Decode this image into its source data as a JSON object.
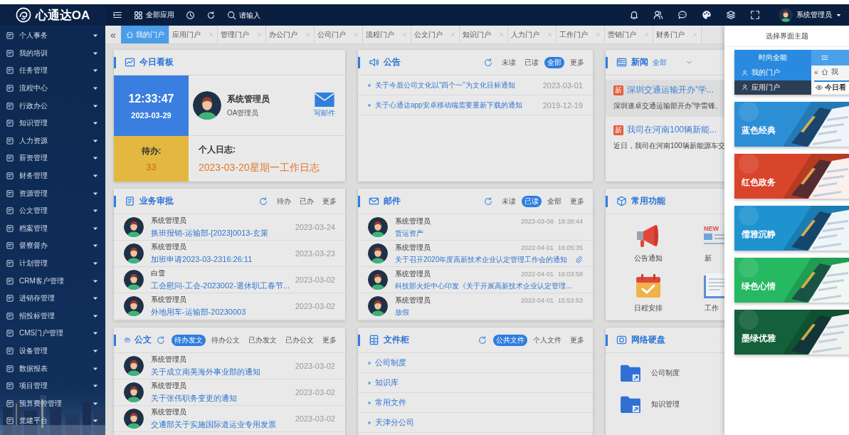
{
  "brand": {
    "name": "心通达OA"
  },
  "sidebar": {
    "items": [
      {
        "label": "个人事务"
      },
      {
        "label": "我的培训"
      },
      {
        "label": "任务管理"
      },
      {
        "label": "流程中心"
      },
      {
        "label": "行政办公"
      },
      {
        "label": "知识管理"
      },
      {
        "label": "人力资源"
      },
      {
        "label": "薪资管理"
      },
      {
        "label": "财务管理"
      },
      {
        "label": "资源管理"
      },
      {
        "label": "公文管理"
      },
      {
        "label": "档案管理"
      },
      {
        "label": "督察督办"
      },
      {
        "label": "计划管理"
      },
      {
        "label": "CRM客户管理"
      },
      {
        "label": "进销存管理"
      },
      {
        "label": "招投标管理"
      },
      {
        "label": "CMS门户管理"
      },
      {
        "label": "设备管理"
      },
      {
        "label": "数据报表"
      },
      {
        "label": "项目管理"
      },
      {
        "label": "预算费控管理"
      },
      {
        "label": "党建平台"
      }
    ]
  },
  "topbar": {
    "apps_button": "全部应用",
    "search": {
      "placeholder": "请输入"
    },
    "user_name": "系统管理员"
  },
  "tabs": {
    "collapse": "«",
    "items": [
      {
        "label": "我的门户",
        "selected": true
      },
      {
        "label": "应用门户",
        "selected": false
      },
      {
        "label": "管理门户",
        "selected": false
      },
      {
        "label": "办公门户",
        "selected": false
      },
      {
        "label": "公司门户",
        "selected": false
      },
      {
        "label": "流程门户",
        "selected": false
      },
      {
        "label": "公文门户",
        "selected": false
      },
      {
        "label": "知识门户",
        "selected": false
      },
      {
        "label": "人力门户",
        "selected": false
      },
      {
        "label": "工作门户",
        "selected": false
      },
      {
        "label": "营销门户",
        "selected": false
      },
      {
        "label": "财务门户",
        "selected": false
      }
    ]
  },
  "panels": [
    {
      "kind": "dashboard",
      "title": "今日看板",
      "time": "12:33:47",
      "date": "2023-03-29",
      "user": "系统管理员",
      "role": "OA管理员",
      "compose": "写邮件",
      "todo_label": "待办:",
      "todo_count": "33",
      "log_label": "个人日志:",
      "log_entry": "2023-03-20星期一工作日志"
    },
    {
      "kind": "notice",
      "title": "公告",
      "filters": [
        {
          "label": "未读",
          "selected": false
        },
        {
          "label": "已读",
          "selected": false
        },
        {
          "label": "全部",
          "selected": true
        }
      ],
      "more": "更多",
      "items": [
        {
          "title": "关于今后公司文化以“四个一”为文化目标通知",
          "date": "2023-03-01"
        },
        {
          "title": "关于心通达app安卓移动端需要重新下载的通知",
          "date": "2019-12-19"
        }
      ]
    },
    {
      "kind": "news",
      "title": "新闻",
      "scope": "全部",
      "items": [
        {
          "badge": "新",
          "title": "深圳交通运输开办”学...",
          "summary": "深圳速卓交通运输部开办”学雷锋、",
          "selected": true
        },
        {
          "badge": "新",
          "title": "我司在河南100辆新能...",
          "summary": "近日，我司在河南100辆新能源车交",
          "selected": false
        }
      ]
    },
    {
      "kind": "approval",
      "title": "业务审批",
      "filters": [
        {
          "label": "待办",
          "selected": false
        },
        {
          "label": "已办",
          "selected": false
        }
      ],
      "more": "更多",
      "items": [
        {
          "sender": "系统管理员",
          "title": "换班报销-运输部-[2023]0013-玄策",
          "date": "2023-03-24"
        },
        {
          "sender": "系统管理员",
          "title": "加班申请2023-03-2316:26:11",
          "date": "2023-03-23"
        },
        {
          "sender": "白雪",
          "title": "工会慰问-工会-2023002-退休职工春节...",
          "date": "2023-03-02"
        },
        {
          "sender": "系统管理员",
          "title": "外地用车-运输部-20230003",
          "date": "2023-03-02"
        }
      ]
    },
    {
      "kind": "mail",
      "title": "邮件",
      "filters": [
        {
          "label": "未读",
          "selected": false
        },
        {
          "label": "已读",
          "selected": true
        },
        {
          "label": "全部",
          "selected": false
        }
      ],
      "more": "更多",
      "items": [
        {
          "sender": "系统管理员",
          "title": "货运资产",
          "date": "2023-03-08",
          "time": "18:38:44",
          "attachment": false
        },
        {
          "sender": "系统管理员",
          "title": "关于召开2020年度高新技术企业认定管理工作会的通知",
          "date": "2022-04-01",
          "time": "16:05:35",
          "attachment": true
        },
        {
          "sender": "系统管理员",
          "title": "科技部火炬中心印发《关于开展高新技术企业认定管理...",
          "date": "2022-04-01",
          "time": "16:03:58",
          "attachment": false
        },
        {
          "sender": "系统管理员",
          "title": "放假",
          "date": "2022-04-01",
          "time": "15:53:53",
          "attachment": false
        }
      ]
    },
    {
      "kind": "functions",
      "title": "常用功能",
      "newspaper_badge": "NEW",
      "items": [
        {
          "kind": "megaphone",
          "label": "公告通知"
        },
        {
          "kind": "newspaper",
          "label": "新"
        },
        {
          "kind": "calendar",
          "label": "日程安排"
        },
        {
          "kind": "notebook",
          "label": "工作"
        }
      ]
    },
    {
      "kind": "documents",
      "title": "公文",
      "filters": [
        {
          "label": "待办发文",
          "selected": true
        },
        {
          "label": "待办公文",
          "selected": false
        },
        {
          "label": "已办发文",
          "selected": false
        },
        {
          "label": "已办公文",
          "selected": false
        }
      ],
      "more": "更多",
      "items": [
        {
          "sender": "系统管理员",
          "title": "关于成立南美海外事业部的通知",
          "date": "2023-03-02"
        },
        {
          "sender": "系统管理员",
          "title": "关于张伟职务变更的通知",
          "date": "2023-03-02"
        },
        {
          "sender": "系统管理员",
          "title": "交通部关于实施国际道运业专用发票",
          "date": "2023-03-02"
        }
      ]
    },
    {
      "kind": "files",
      "title": "文件柜",
      "filters": [
        {
          "label": "公共文件",
          "selected": true
        },
        {
          "label": "个人文件",
          "selected": false
        }
      ],
      "more": "更多",
      "items": [
        {
          "title": "公司制度"
        },
        {
          "title": "知识库"
        },
        {
          "title": "常用文件"
        },
        {
          "title": "天津分公司"
        }
      ]
    },
    {
      "kind": "disk",
      "title": "网络硬盘",
      "items": [
        {
          "label": "公司制度"
        },
        {
          "label": "知识管理"
        }
      ]
    }
  ],
  "theme_drawer": {
    "title": "选择界面主题",
    "themes": [
      {
        "kind": "preview",
        "title": "时尚全能",
        "color": "#2a8ae0",
        "menu": [
          {
            "label": "我的门户",
            "selected": true
          },
          {
            "label": "应用门户",
            "selected": false
          }
        ],
        "collapse": "«",
        "tab": "我",
        "panel": "今日看"
      },
      {
        "kind": "thumbnail",
        "label": "蓝色经典",
        "color": "#2c8fd6"
      },
      {
        "kind": "thumbnail",
        "label": "红色政务",
        "color": "#d8452a"
      },
      {
        "kind": "thumbnail",
        "label": "儒雅沉静",
        "color": "#1f93d0"
      },
      {
        "kind": "thumbnail",
        "label": "绿色心情",
        "color": "#27b862"
      },
      {
        "kind": "thumbnail",
        "label": "墨绿优雅",
        "color": "#13603a"
      }
    ]
  }
}
